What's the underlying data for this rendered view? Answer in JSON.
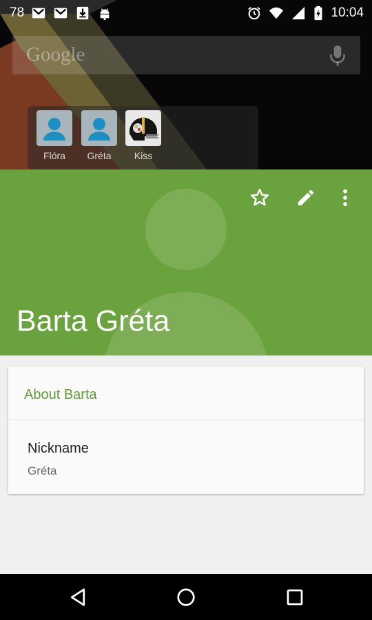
{
  "status_bar": {
    "notification_count": "78",
    "time": "10:04",
    "left_icons": [
      "gmail-icon",
      "gmail-icon",
      "download-icon",
      "android-debug-icon"
    ],
    "right_icons": [
      "alarm-icon",
      "wifi-icon",
      "signal-icon",
      "battery-charging-icon"
    ]
  },
  "launcher": {
    "search_logo": "Google",
    "shortcuts": [
      {
        "label": "Flóra",
        "icon": "contact-avatar-icon"
      },
      {
        "label": "Gréta",
        "icon": "contact-avatar-icon"
      },
      {
        "label": "Kiss",
        "icon": "helmet-photo-icon"
      }
    ]
  },
  "contact": {
    "name": "Barta Gréta",
    "header_color": "#6aa33d",
    "actions": [
      "star-icon",
      "edit-icon",
      "more-vert-icon"
    ]
  },
  "about_card": {
    "title": "About Barta",
    "field_label": "Nickname",
    "field_value": "Gréta"
  },
  "navigation": {
    "buttons": [
      "back-icon",
      "home-icon",
      "recents-icon"
    ]
  },
  "colors": {
    "accent": "#6aa33d",
    "title_green": "#5f9e36",
    "background": "#f0f0f0"
  }
}
